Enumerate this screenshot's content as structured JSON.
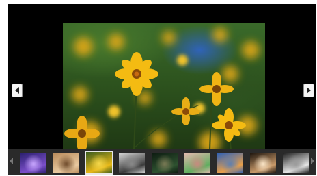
{
  "viewer": {
    "current_index": 3,
    "thumbnails": [
      {
        "name": "thumb-purple-sky",
        "colors": [
          "#2a1f6e",
          "#7b4fc9",
          "#c9a7ff"
        ]
      },
      {
        "name": "thumb-woman-portrait",
        "colors": [
          "#b88a5a",
          "#e8c9a0",
          "#6e4a2a"
        ]
      },
      {
        "name": "thumb-yellow-flowers",
        "colors": [
          "#3a5c1e",
          "#e8b818",
          "#f6d84a"
        ]
      },
      {
        "name": "thumb-man-in-suit",
        "colors": [
          "#d9d9d9",
          "#3b3b3b",
          "#8a8a8a"
        ]
      },
      {
        "name": "thumb-dark-landscape",
        "colors": [
          "#0c1a10",
          "#2e5230",
          "#7a7a55"
        ]
      },
      {
        "name": "thumb-green-figures",
        "colors": [
          "#e6b8b0",
          "#5fae5f",
          "#c98a7f"
        ]
      },
      {
        "name": "thumb-blue-mountains",
        "colors": [
          "#2a5fb8",
          "#e9a04a",
          "#5e7fb0"
        ]
      },
      {
        "name": "thumb-couple",
        "colors": [
          "#1a120c",
          "#c99a6a",
          "#fbe6c8"
        ]
      },
      {
        "name": "thumb-baby-sleeping",
        "colors": [
          "#1c1c1c",
          "#e6e6e6",
          "#9a9a9a"
        ]
      }
    ]
  },
  "icons": {
    "prev": "chevron-left-icon",
    "next": "chevron-right-icon",
    "pause": "pause-icon",
    "stop": "stop-icon",
    "info": "info-icon"
  },
  "colors": {
    "background": "#000000",
    "filmstrip": "#2a2a2a",
    "flower": "#f2b714",
    "flower_center": "#8a4a08"
  }
}
